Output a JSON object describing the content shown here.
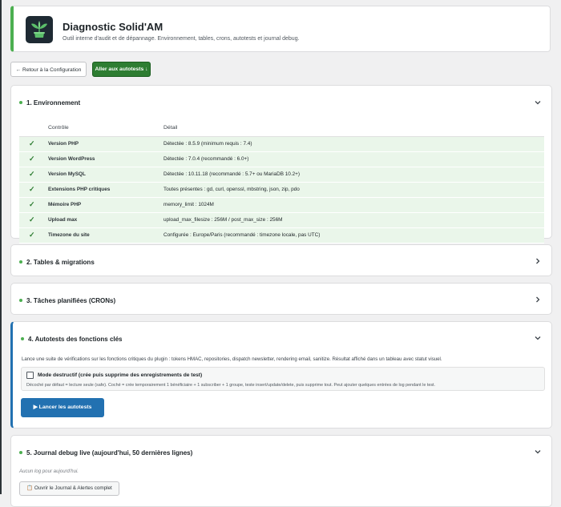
{
  "header": {
    "title": "Diagnostic Solid'AM",
    "subtitle": "Outil interne d'audit et de dépannage. Environnement, tables, crons, autotests et journal debug."
  },
  "toolbar": {
    "back_label": "← Retour à la Configuration",
    "go_label": "Aller aux autotests ↓"
  },
  "sections": {
    "env": {
      "title": "1. Environnement",
      "col_control": "Contrôle",
      "col_detail": "Détail",
      "rows": [
        {
          "check": "✓",
          "control": "Version PHP",
          "detail": "Détectée : 8.5.9 (minimum requis : 7.4)"
        },
        {
          "check": "✓",
          "control": "Version WordPress",
          "detail": "Détectée : 7.0.4 (recommandé : 6.0+)"
        },
        {
          "check": "✓",
          "control": "Version MySQL",
          "detail": "Détectée : 10.11.18 (recommandé : 5.7+ ou MariaDB 10.2+)"
        },
        {
          "check": "✓",
          "control": "Extensions PHP critiques",
          "detail": "Toutes présentes : gd, curl, openssl, mbstring, json, zip, pdo"
        },
        {
          "check": "✓",
          "control": "Mémoire PHP",
          "detail": "memory_limit : 1024M"
        },
        {
          "check": "✓",
          "control": "Upload max",
          "detail": "upload_max_filesize : 256M / post_max_size : 256M"
        },
        {
          "check": "✓",
          "control": "Timezone du site",
          "detail": "Configurée : Europe/Paris (recommandé : timezone locale, pas UTC)"
        }
      ]
    },
    "tables": {
      "title": "2. Tables & migrations"
    },
    "crons": {
      "title": "3. Tâches planifiées (CRONs)"
    },
    "autotests": {
      "title": "4. Autotests des fonctions clés",
      "description": "Lance une suite de vérifications sur les fonctions critiques du plugin : tokens HMAC, repositories, dispatch newsletter, rendering email, sanitize. Résultat affiché dans un tableau avec statut visuel.",
      "destructive_label": "Mode destructif (crée puis supprime des enregistrements de test)",
      "destructive_help": "Décoché par défaut = lecture seule (safe). Coché = crée temporairement 1 bénéficiaire + 1 subscriber + 1 groupe, teste insert/update/delete, puis supprime tout. Peut ajouter quelques entrées de log pendant le test.",
      "run_label": "▶ Lancer les autotests"
    },
    "journal": {
      "title": "5. Journal debug live (aujourd'hui, 50 dernières lignes)",
      "empty": "Aucun log pour aujourd'hui.",
      "open_label": "📋 Ouvrir le Journal & Alertes complet"
    }
  },
  "colors": {
    "accent_green": "#4caf50",
    "button_green": "#2e7d32",
    "button_blue": "#2271b1",
    "row_ok": "#eaf6ea"
  }
}
